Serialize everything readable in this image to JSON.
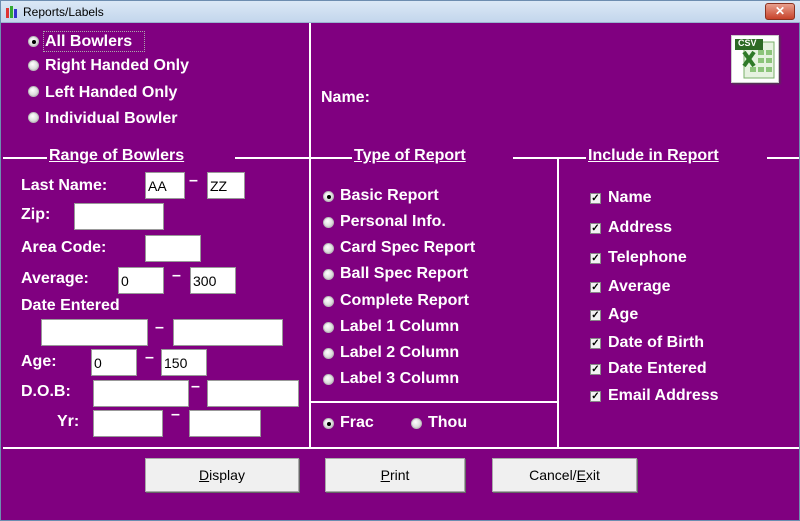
{
  "window": {
    "title": "Reports/Labels",
    "close_label": "✕",
    "background_color": "#800080"
  },
  "bowler_filter": {
    "options": [
      {
        "label": "All Bowlers",
        "checked": true
      },
      {
        "label": "Right Handed Only",
        "checked": false
      },
      {
        "label": "Left Handed Only",
        "checked": false
      },
      {
        "label": "Individual Bowler",
        "checked": false
      }
    ]
  },
  "name_label": "Name:",
  "csv_icon_label": "CSV",
  "range": {
    "title": "Range of Bowlers",
    "last_name_label": "Last Name:",
    "last_name_from": "AA",
    "last_name_to": "ZZ",
    "zip_label": "Zip:",
    "zip_value": "",
    "area_code_label": "Area Code:",
    "area_code_value": "",
    "average_label": "Average:",
    "average_from": "0",
    "average_to": "300",
    "date_entered_label": "Date Entered",
    "date_entered_from": "",
    "date_entered_to": "",
    "age_label": "Age:",
    "age_from": "0",
    "age_to": "150",
    "dob_label": "D.O.B:",
    "dob_from": "",
    "dob_to": "",
    "yr_label": "Yr:",
    "yr_from": "",
    "yr_to": "",
    "dash": "–"
  },
  "report_type": {
    "title": "Type of Report",
    "options": [
      {
        "label": "Basic Report",
        "checked": true
      },
      {
        "label": "Personal Info.",
        "checked": false
      },
      {
        "label": "Card Spec Report",
        "checked": false
      },
      {
        "label": "Ball Spec Report",
        "checked": false
      },
      {
        "label": "Complete Report",
        "checked": false
      },
      {
        "label": "Label 1 Column",
        "checked": false
      },
      {
        "label": "Label 2 Column",
        "checked": false
      },
      {
        "label": "Label 3 Column",
        "checked": false
      }
    ]
  },
  "format": {
    "options": [
      {
        "label": "Frac",
        "checked": true
      },
      {
        "label": "Thou",
        "checked": false
      }
    ]
  },
  "include": {
    "title": "Include in Report",
    "items": [
      {
        "label": "Name",
        "checked": true
      },
      {
        "label": "Address",
        "checked": true
      },
      {
        "label": "Telephone",
        "checked": true
      },
      {
        "label": "Average",
        "checked": true
      },
      {
        "label": "Age",
        "checked": true
      },
      {
        "label": "Date of Birth",
        "checked": true
      },
      {
        "label": "Date Entered",
        "checked": true
      },
      {
        "label": "Email Address",
        "checked": true
      }
    ]
  },
  "buttons": {
    "display": {
      "mnemonic": "D",
      "rest": "isplay"
    },
    "print": {
      "mnemonic": "P",
      "rest": "rint"
    },
    "cancel": {
      "pre": "Cancel/",
      "mnemonic": "E",
      "rest": "xit"
    }
  }
}
